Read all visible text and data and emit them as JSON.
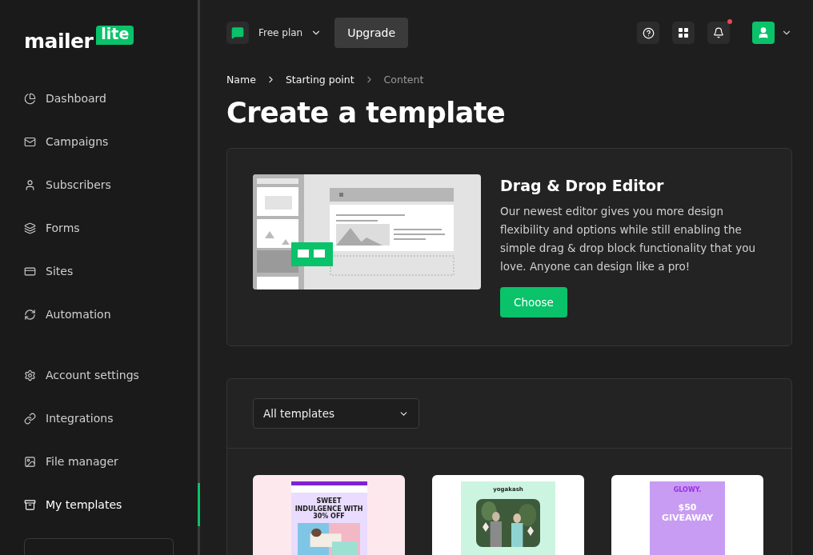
{
  "logo": {
    "word": "mailer",
    "badge": "lite"
  },
  "sidebar": {
    "groups": [
      {
        "items": [
          {
            "label": "Dashboard",
            "selected": false
          },
          {
            "label": "Campaigns",
            "selected": false
          },
          {
            "label": "Subscribers",
            "selected": false
          },
          {
            "label": "Forms",
            "selected": false
          },
          {
            "label": "Sites",
            "selected": false
          },
          {
            "label": "Automation",
            "selected": false
          }
        ]
      },
      {
        "items": [
          {
            "label": "Account settings",
            "selected": false
          },
          {
            "label": "Integrations",
            "selected": false
          },
          {
            "label": "File manager",
            "selected": false
          },
          {
            "label": "My templates",
            "selected": true
          }
        ]
      }
    ]
  },
  "header": {
    "plan": "Free plan",
    "upgrade": "Upgrade",
    "notifications_unread": true
  },
  "breadcrumb": [
    {
      "label": "Name",
      "current": false
    },
    {
      "label": "Starting point",
      "current": false
    },
    {
      "label": "Content",
      "current": true
    }
  ],
  "title": "Create a template",
  "editor_card": {
    "heading": "Drag & Drop Editor",
    "description": "Our newest editor gives you more design flexibility and options while still enabling the simple drag & drop block functionality that you love. Anyone can design like a pro!",
    "button": "Choose"
  },
  "filter": {
    "value": "All templates"
  },
  "templates": [
    {
      "kind": "sale",
      "texts": [
        "SWEET INDULGENCE WITH 30% OFF"
      ]
    },
    {
      "kind": "brand",
      "texts": [
        "yogakash"
      ]
    },
    {
      "kind": "giveaway",
      "texts": [
        "GLOWY.",
        "$50 GIVEAWAY"
      ]
    }
  ]
}
